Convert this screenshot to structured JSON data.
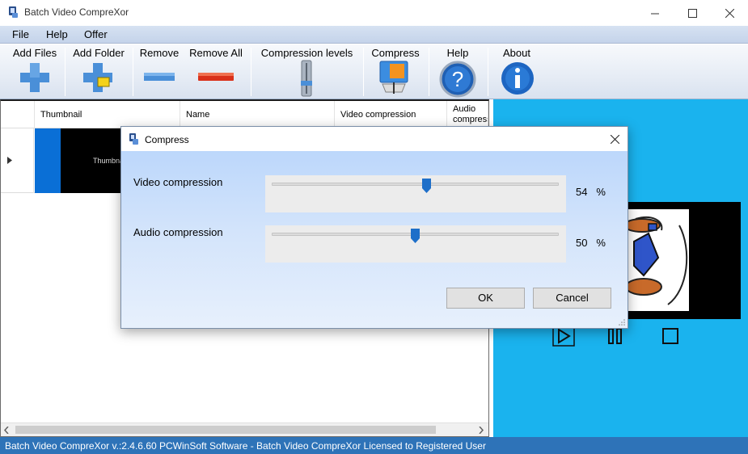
{
  "window": {
    "title": "Batch Video CompreXor",
    "minimize_glyph": "—",
    "maximize_glyph": "☐",
    "close_glyph": "✕"
  },
  "menu": [
    "File",
    "Help",
    "Offer"
  ],
  "toolbar": {
    "add_files": "Add Files",
    "add_folder": "Add Folder",
    "remove": "Remove",
    "remove_all": "Remove All",
    "compression_levels": "Compression levels",
    "compress": "Compress",
    "help": "Help",
    "about": "About"
  },
  "grid": {
    "columns": [
      "Thumbnail",
      "Name",
      "Video compression",
      "Audio compress"
    ],
    "rows": [
      {
        "thumbnail_text": "Thumbnail"
      }
    ]
  },
  "dialog": {
    "title": "Compress",
    "close_glyph": "✕",
    "video_label": "Video compression",
    "video_value": "54",
    "video_fraction": 0.54,
    "audio_label": "Audio compression",
    "audio_value": "50",
    "audio_fraction": 0.5,
    "percent_sign": "%",
    "ok_label": "OK",
    "cancel_label": "Cancel"
  },
  "statusbar": {
    "text": "Batch Video CompreXor v.:2.4.6.60 PCWinSoft Software - Batch Video CompreXor Licensed to Registered User"
  },
  "colors": {
    "player_background": "#1ab3ee",
    "statusbar": "#2e73b8",
    "slider_thumb": "#1e6fc9"
  }
}
